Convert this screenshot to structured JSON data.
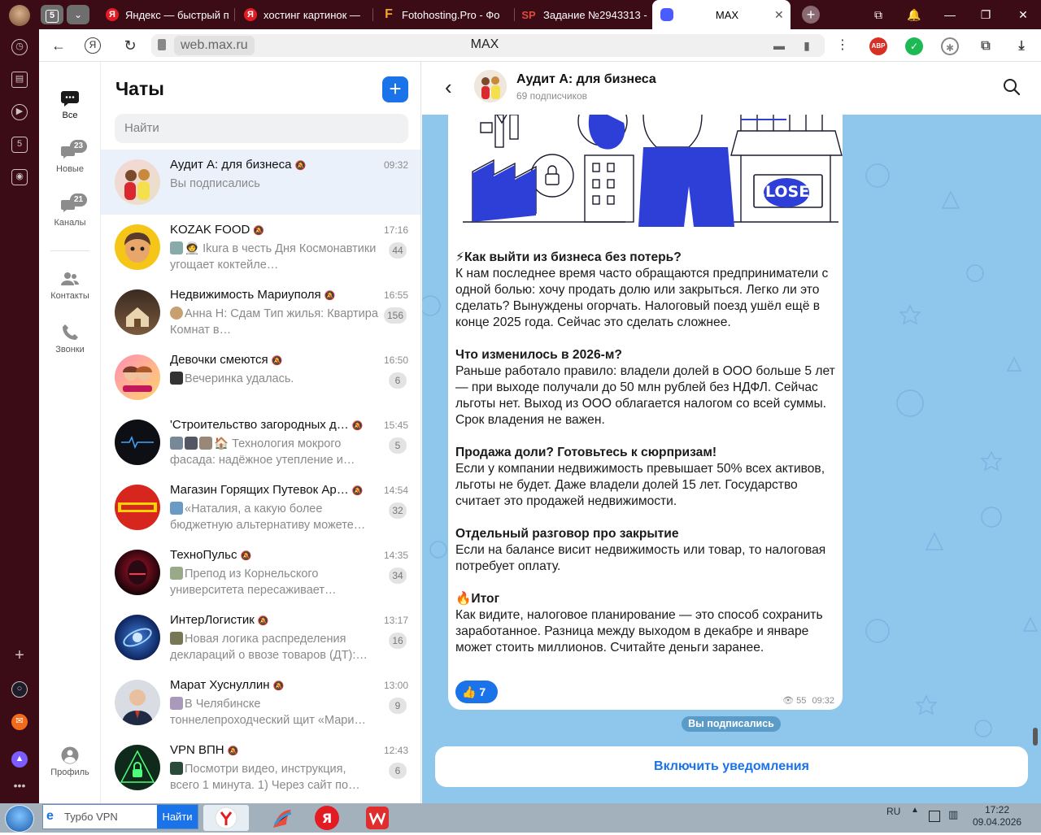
{
  "browser": {
    "tab_count": "5",
    "tabs": [
      {
        "title": "Яндекс — быстрый п",
        "icon": "Я",
        "color": "#e31b23"
      },
      {
        "title": "хостинг картинок —",
        "icon": "Я",
        "color": "#e31b23"
      },
      {
        "title": "Fotohosting.Pro - Фо",
        "icon": "F",
        "color": "#f5a623"
      },
      {
        "title": "Задание №2943313 -",
        "icon": "SP",
        "color": "#c0392b"
      },
      {
        "title": "MAX",
        "icon": "",
        "color": "#4a5cff"
      }
    ],
    "url": "web.max.ru",
    "page_title": "MAX"
  },
  "sidenav": {
    "items": [
      {
        "label": "Все",
        "badge": ""
      },
      {
        "label": "Новые",
        "badge": "23"
      },
      {
        "label": "Каналы",
        "badge": "21"
      },
      {
        "label": "Контакты",
        "badge": ""
      },
      {
        "label": "Звонки",
        "badge": ""
      }
    ],
    "profile_label": "Профиль"
  },
  "chatlist": {
    "title": "Чаты",
    "search_placeholder": "Найти",
    "chats": [
      {
        "name": "Аудит А: для бизнеса",
        "time": "09:32",
        "preview": "Вы подписались",
        "count": "",
        "selected": true
      },
      {
        "name": "KOZAK FOOD",
        "time": "17:16",
        "preview": "🧑‍🚀 Ikura в честь Дня Космонавтики угощает коктейле…",
        "count": "44"
      },
      {
        "name": "Недвижимость Мариуполя",
        "time": "16:55",
        "preview": "Анна Н:      Сдам Тип жилья: Квартира Комнат в…",
        "count": "156"
      },
      {
        "name": "Девочки смеются",
        "time": "16:50",
        "preview": "Вечеринка удалась.",
        "count": "6"
      },
      {
        "name": "'Строительство загородных д…",
        "time": "15:45",
        "preview": "🏠 Технология мокрого фасада: надёжное утепление и…",
        "count": "5"
      },
      {
        "name": "Магазин Горящих Путевок Ар…",
        "time": "14:54",
        "preview": "«Наталия, а какую более бюджетную альтернативу можете…",
        "count": "32"
      },
      {
        "name": "ТехноПульс",
        "time": "14:35",
        "preview": "Препод из Корнельского университета пересаживает…",
        "count": "34"
      },
      {
        "name": "ИнтерЛогистик",
        "time": "13:17",
        "preview": "Новая логика распределения деклараций о ввозе товаров (ДТ):…",
        "count": "16"
      },
      {
        "name": "Марат Хуснуллин",
        "time": "13:00",
        "preview": "В Челябинске тоннелепроходческий щит «Мари…",
        "count": "9"
      },
      {
        "name": "VPN ВПН",
        "time": "12:43",
        "preview": "Посмотри видео, инструкция, всего 1 минута. 1) Через сайт по…",
        "count": "6"
      }
    ]
  },
  "channel": {
    "name": "Аудит А: для бизнеса",
    "subscribers": "69 подписчиков",
    "closed_sign": "CLOSED",
    "message": {
      "h1": "⚡Как выйти из бизнеса без потерь?",
      "p1": "К нам последнее время часто обращаются предприниматели с одной болью: хочу продать долю или закрыться. Легко ли это сделать?  Вынуждены огорчать. Налоговый поезд ушёл ещё в конце 2025 года. Сейчас это сделать сложнее.",
      "h2": "Что изменилось в 2026-м?",
      "p2": "Раньше работало правило: владели долей в ООО больше 5 лет — при выходе получали до 50 млн рублей без НДФЛ. Сейчас льготы нет. Выход из ООО облагается налогом со всей суммы. Срок владения не важен.",
      "h3": "Продажа доли? Готовьтесь к сюрпризам!",
      "p3": "Если у компании недвижимость превышает 50% всех активов, льготы не будет. Даже владели долей 15 лет. Государство считает это продажей недвижимости.",
      "h4": "Отдельный разговор про закрытие",
      "p4": "Если на балансе висит недвижимость или товар, то налоговая потребует оплату.",
      "h5": "🔥Итог",
      "p5": "Как видите, налоговое планирование — это способ сохранить заработанное. Разница между выходом в декабре и январе может стоить миллионов. Считайте деньги заранее.",
      "reaction": "👍 7",
      "views": "55",
      "time": "09:32"
    },
    "subscribed_pill": "Вы подписались",
    "notify_button": "Включить уведомления"
  },
  "taskbar": {
    "search_text": "Турбо VPN",
    "search_button": "Найти",
    "lang": "RU",
    "time": "17:22",
    "date": "09.04.2026"
  }
}
